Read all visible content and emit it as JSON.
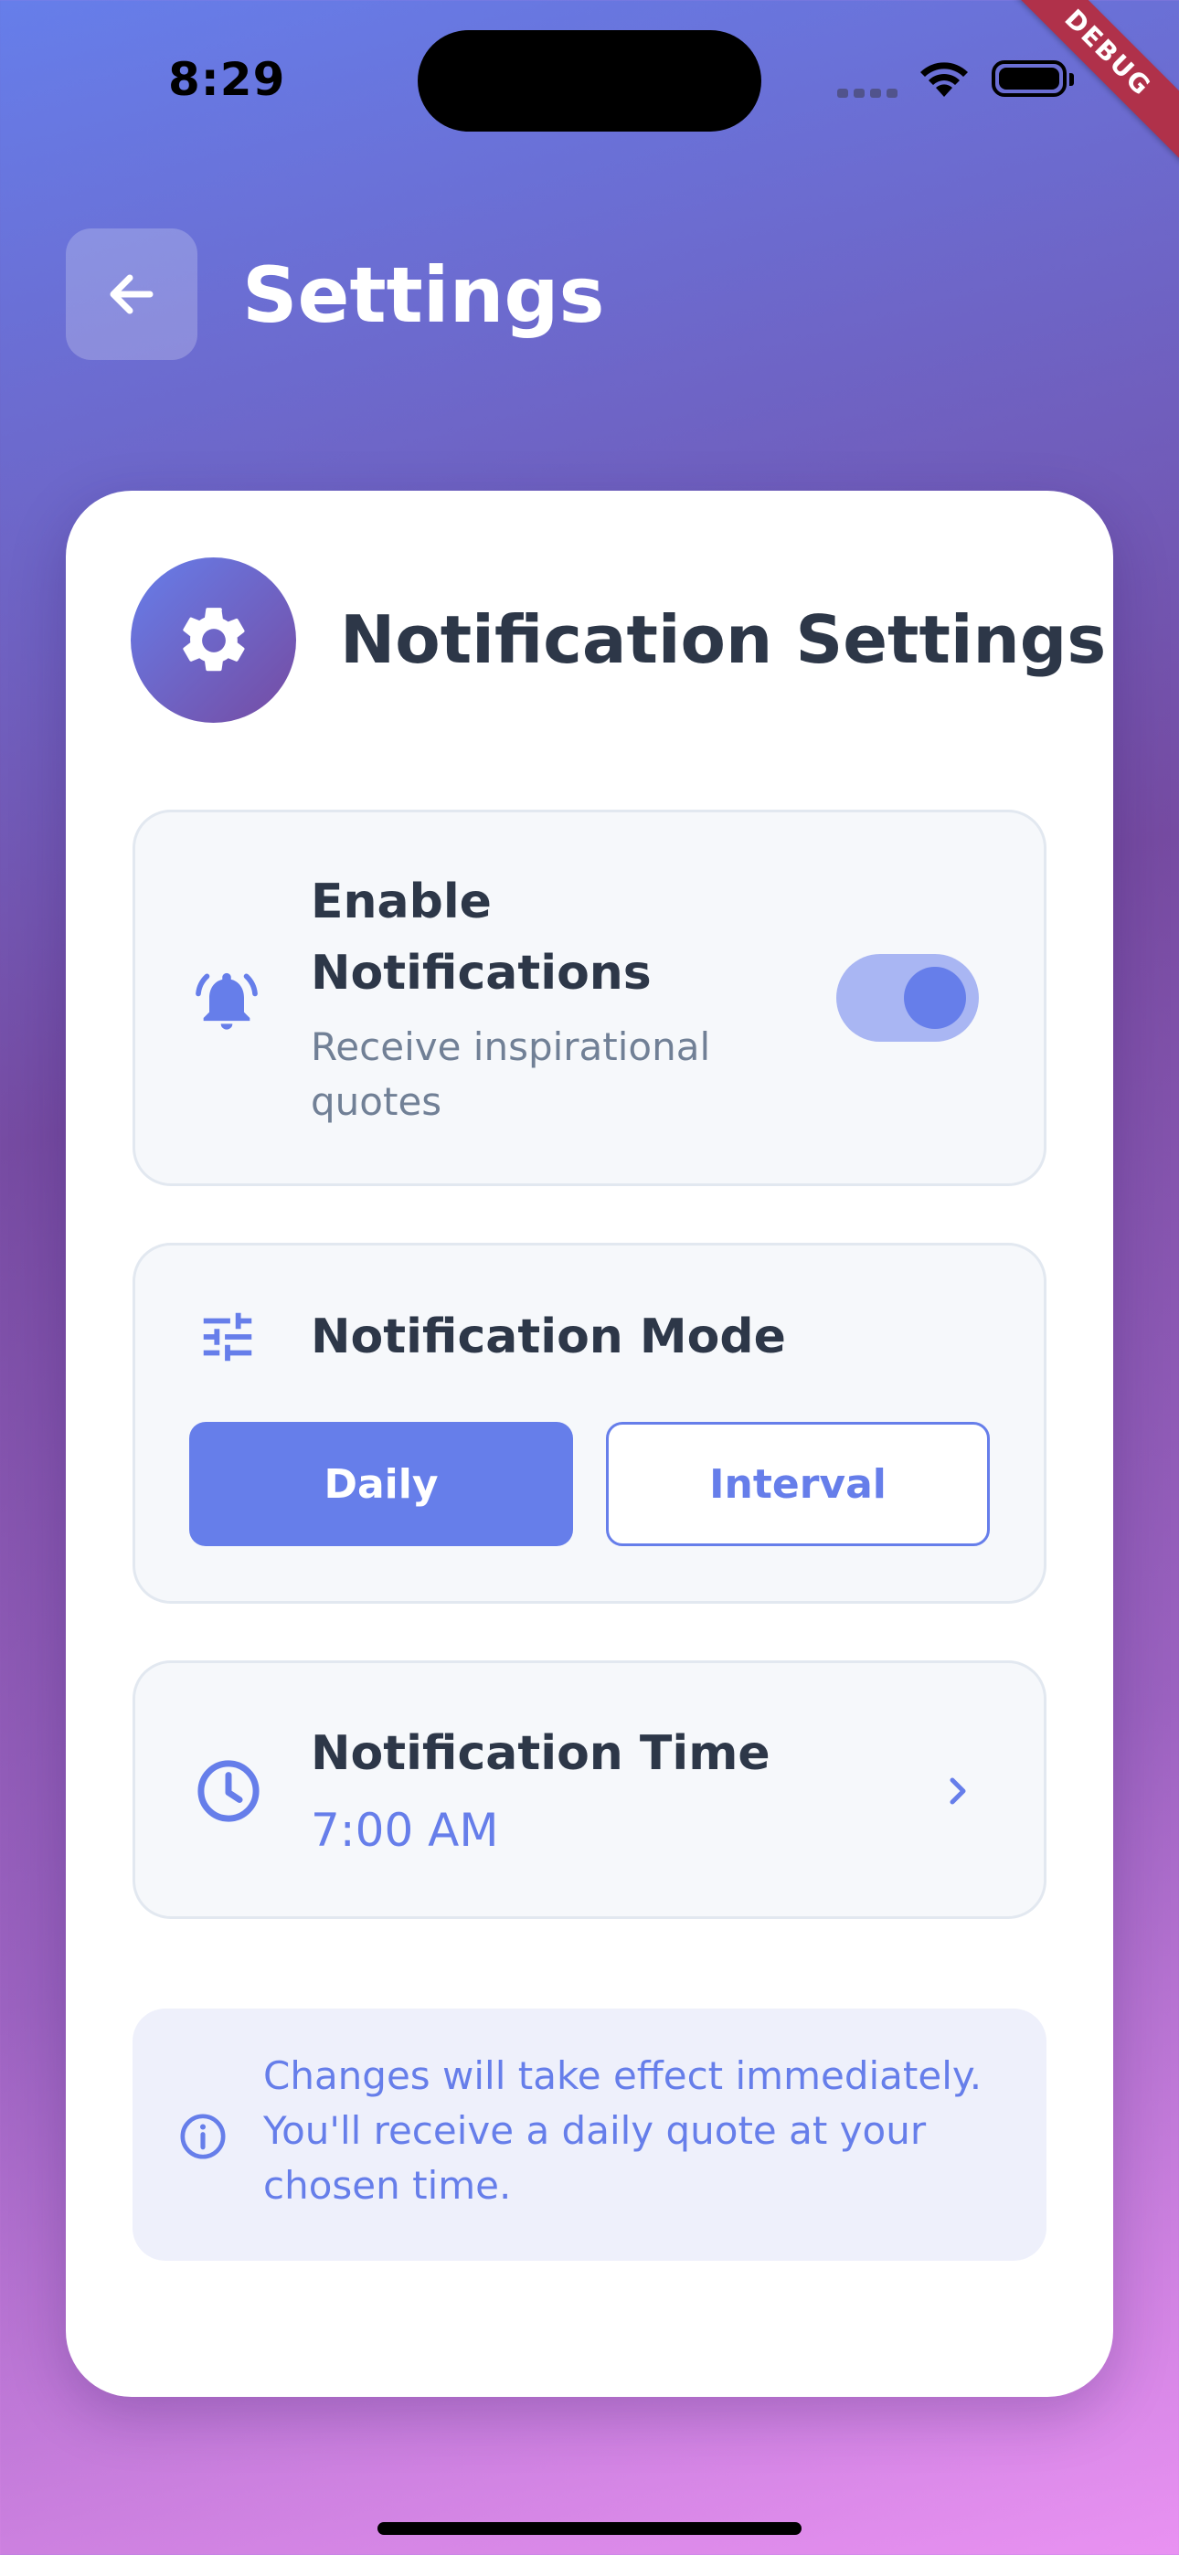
{
  "status_bar": {
    "time": "8:29",
    "debug_label": "DEBUG"
  },
  "header": {
    "title": "Settings",
    "back_icon": "arrow-left-icon"
  },
  "card": {
    "title": "Notification Settings",
    "icon": "gear-icon",
    "enable": {
      "title": "Enable Notifications",
      "subtitle": "Receive inspirational quotes",
      "icon": "bell-icon",
      "enabled": true
    },
    "mode": {
      "title": "Notification Mode",
      "icon": "sliders-icon",
      "options": [
        "Daily",
        "Interval"
      ],
      "selected": "Daily"
    },
    "time": {
      "title": "Notification Time",
      "value": "7:00 AM",
      "icon": "clock-icon"
    },
    "info": {
      "text": "Changes will take effect immediately. You'll receive a daily quote at your chosen time.",
      "icon": "info-icon"
    }
  },
  "colors": {
    "accent": "#667eea",
    "gradient_start": "#667eea",
    "gradient_end": "#764ba2",
    "text_dark": "#2d3748",
    "text_muted": "#718096"
  }
}
